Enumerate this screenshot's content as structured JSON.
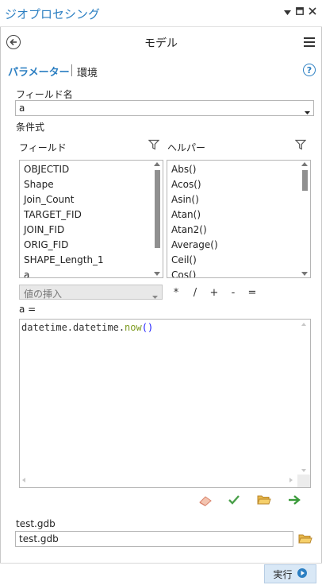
{
  "window": {
    "title": "ジオプロセシング",
    "pin_icon": "pin-icon",
    "restore_icon": "restore-icon",
    "close_icon": "close-icon"
  },
  "header": {
    "title": "モデル",
    "back_icon": "back-arrow-icon",
    "menu_icon": "hamburger-menu-icon"
  },
  "tabs": [
    {
      "label": "パラメーター",
      "active": true
    },
    {
      "label": "環境",
      "active": false
    }
  ],
  "help_icon": "?",
  "field_name": {
    "label": "フィールド名",
    "value": "a"
  },
  "expression": {
    "label": "条件式",
    "fields_label": "フィールド",
    "helpers_label": "ヘルパー",
    "fields": [
      "OBJECTID",
      "Shape",
      "Join_Count",
      "TARGET_FID",
      "JOIN_FID",
      "ORIG_FID",
      "SHAPE_Length_1",
      "a"
    ],
    "helpers": [
      "Abs()",
      "Acos()",
      "Asin()",
      "Atan()",
      "Atan2()",
      "Average()",
      "Ceil()",
      "Cos()"
    ],
    "insert_values_placeholder": "値の挿入",
    "operators": [
      "*",
      "/",
      "+",
      "-",
      "="
    ],
    "target_label": "a =",
    "code_prefix": "datetime.datetime.",
    "code_func": "now",
    "code_parens": "()"
  },
  "expression_tools": {
    "eraser_icon": "eraser-icon",
    "verify_icon": "checkmark-icon",
    "load_icon": "open-folder-icon",
    "save_icon": "green-arrow-icon"
  },
  "workspace": {
    "label": "test.gdb",
    "value": "test.gdb",
    "browse_icon": "folder-icon"
  },
  "run_button": {
    "label": "実行",
    "icon": "play-icon"
  },
  "colors": {
    "accent": "#2c7fc2",
    "code_func": "#7c9a1e",
    "code_parens": "#1a1aff",
    "run_button_bg": "#d9e8f6"
  }
}
